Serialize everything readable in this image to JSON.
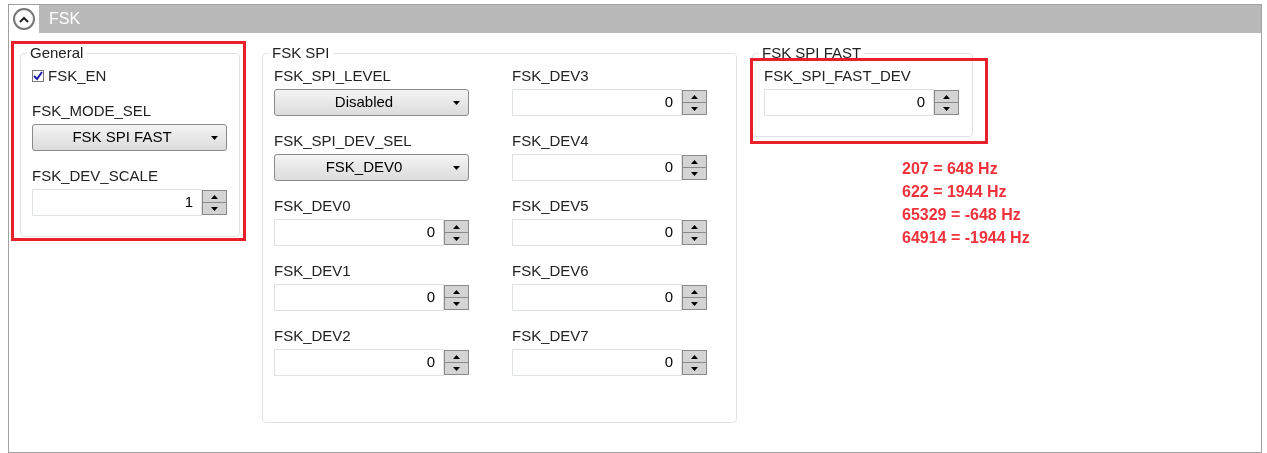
{
  "panel": {
    "title": "FSK",
    "expanded": true
  },
  "groups": [
    {
      "title": "General",
      "highlighted": true,
      "columns": [
        [
          {
            "kind": "checkbox",
            "label": "FSK_EN",
            "checked": true
          },
          {
            "kind": "dropdown",
            "label": "FSK_MODE_SEL",
            "value": "FSK SPI FAST"
          },
          {
            "kind": "spinner",
            "label": "FSK_DEV_SCALE",
            "value": "1"
          }
        ]
      ]
    },
    {
      "title": "FSK SPI",
      "highlighted": false,
      "columns": [
        [
          {
            "kind": "dropdown",
            "label": "FSK_SPI_LEVEL",
            "value": "Disabled"
          },
          {
            "kind": "dropdown",
            "label": "FSK_SPI_DEV_SEL",
            "value": "FSK_DEV0"
          },
          {
            "kind": "spinner",
            "label": "FSK_DEV0",
            "value": "0"
          },
          {
            "kind": "spinner",
            "label": "FSK_DEV1",
            "value": "0"
          },
          {
            "kind": "spinner",
            "label": "FSK_DEV2",
            "value": "0"
          }
        ],
        [
          {
            "kind": "spinner",
            "label": "FSK_DEV3",
            "value": "0"
          },
          {
            "kind": "spinner",
            "label": "FSK_DEV4",
            "value": "0"
          },
          {
            "kind": "spinner",
            "label": "FSK_DEV5",
            "value": "0"
          },
          {
            "kind": "spinner",
            "label": "FSK_DEV6",
            "value": "0"
          },
          {
            "kind": "spinner",
            "label": "FSK_DEV7",
            "value": "0"
          }
        ]
      ]
    },
    {
      "title": "FSK SPI FAST",
      "highlighted": true,
      "columns": [
        [
          {
            "kind": "spinner",
            "label": "FSK_SPI_FAST_DEV",
            "value": "0"
          }
        ]
      ]
    }
  ],
  "notes": [
    "207 = 648 Hz",
    "622 = 1944 Hz",
    "65329 = -648 Hz",
    "64914 = -1944 Hz"
  ]
}
